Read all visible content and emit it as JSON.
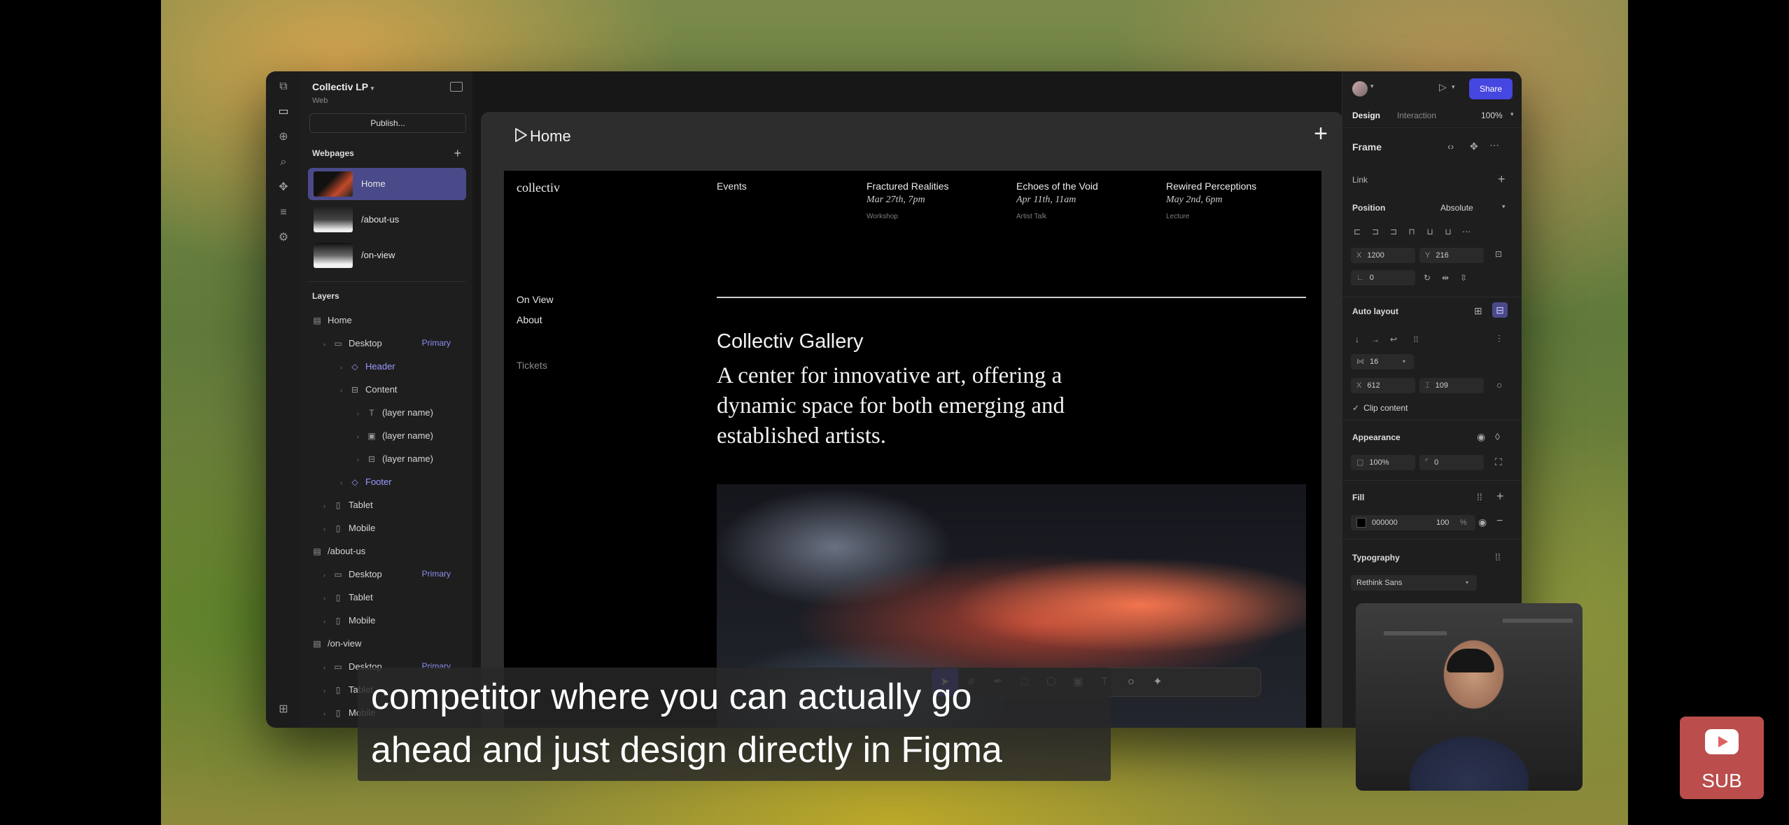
{
  "left_panel": {
    "project_name": "Collectiv LP",
    "project_type": "Web",
    "publish_label": "Publish...",
    "webpages_header": "Webpages",
    "pages": [
      {
        "label": "Home",
        "selected": true
      },
      {
        "label": "/about-us",
        "selected": false
      },
      {
        "label": "/on-view",
        "selected": false
      }
    ],
    "layers_header": "Layers",
    "layers": [
      {
        "label": "Home",
        "icon": "page-icon"
      },
      {
        "label": "Desktop",
        "icon": "desktop-icon",
        "tag": "Primary"
      },
      {
        "label": "Header",
        "icon": "component-icon"
      },
      {
        "label": "Content",
        "icon": "autolayout-icon"
      },
      {
        "label": "(layer name)",
        "icon": "text-icon"
      },
      {
        "label": "(layer name)",
        "icon": "image-icon"
      },
      {
        "label": "(layer name)",
        "icon": "autolayout-icon"
      },
      {
        "label": "Footer",
        "icon": "component-icon"
      },
      {
        "label": "Tablet",
        "icon": "tablet-icon"
      },
      {
        "label": "Mobile",
        "icon": "mobile-icon"
      },
      {
        "label": "/about-us",
        "icon": "page-icon"
      },
      {
        "label": "Desktop",
        "icon": "desktop-icon",
        "tag": "Primary"
      },
      {
        "label": "Tablet",
        "icon": "tablet-icon"
      },
      {
        "label": "Mobile",
        "icon": "mobile-icon"
      },
      {
        "label": "/on-view",
        "icon": "page-icon"
      },
      {
        "label": "Desktop",
        "icon": "desktop-icon",
        "tag": "Primary"
      },
      {
        "label": "Tablet",
        "icon": "tablet-icon"
      },
      {
        "label": "Mobile",
        "icon": "mobile-icon"
      }
    ]
  },
  "canvas": {
    "frame_title": "Home",
    "site": {
      "logo": "collectiv",
      "nav_events": "Events",
      "events": [
        {
          "title": "Fractured Realities",
          "date": "Mar 27th, 7pm",
          "kind": "Workshop"
        },
        {
          "title": "Echoes of the Void",
          "date": "Apr 11th, 11am",
          "kind": "Artist Talk"
        },
        {
          "title": "Rewired Perceptions",
          "date": "May 2nd, 6pm",
          "kind": "Lecture"
        }
      ],
      "nav_on_view": "On View",
      "nav_about": "About",
      "nav_tickets": "Tickets",
      "gallery_title": "Collectiv Gallery",
      "gallery_description": "A center for innovative art, offering a dynamic space for both emerging and established artists."
    }
  },
  "right_panel": {
    "share_label": "Share",
    "tab_design": "Design",
    "tab_interaction": "Interaction",
    "zoom": "100%",
    "frame_label": "Frame",
    "link_label": "Link",
    "position_label": "Position",
    "position_value": "Absolute",
    "x_label": "X",
    "x_value": "1200",
    "y_label": "Y",
    "y_value": "216",
    "rotation_value": "0",
    "auto_layout_label": "Auto layout",
    "gap_value": "16",
    "width_label": "X",
    "width_value": "612",
    "height_value": "109",
    "clip_content_label": "Clip content",
    "appearance_label": "Appearance",
    "opacity_value": "100%",
    "radius_value": "0",
    "fill_label": "Fill",
    "fill_hex": "000000",
    "fill_opacity": "100",
    "fill_percent": "%",
    "typography_label": "Typography",
    "font_value": "Rethink Sans"
  },
  "overlay": {
    "caption_line1": "competitor where you can actually go",
    "caption_line2": "ahead and just design directly in Figma",
    "subscribe_label": "SUB"
  },
  "colors": {
    "accent": "#4646e0",
    "selected_page": "#4a4a8a",
    "component": "#9a9aff"
  }
}
